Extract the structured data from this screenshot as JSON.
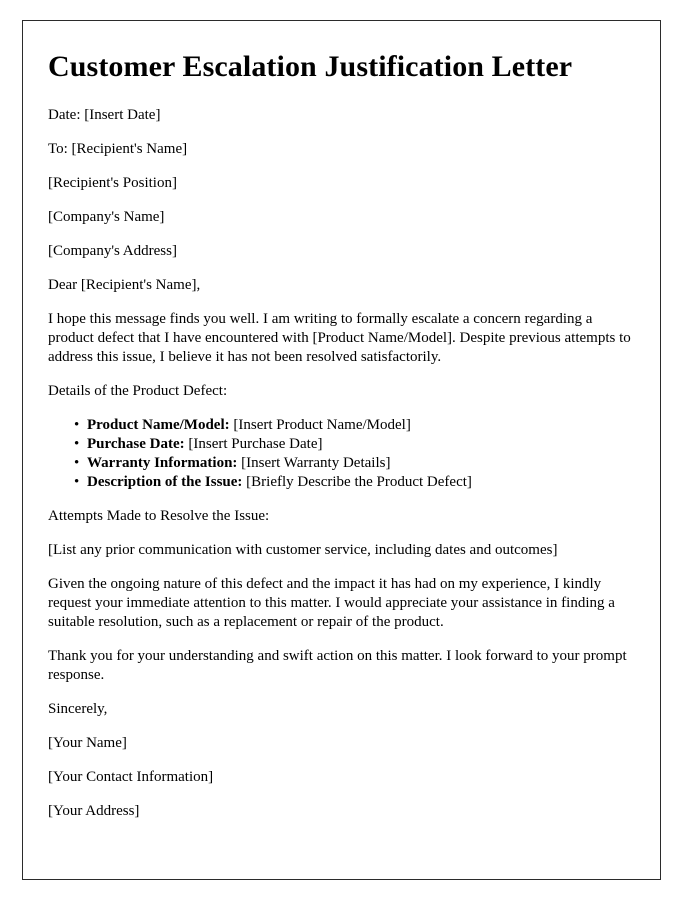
{
  "document": {
    "title": "Customer Escalation Justification Letter",
    "heading_blocks": {
      "date_line": "Date: [Insert Date]",
      "to_line": "To: [Recipient's Name]",
      "recipient_position": "[Recipient's Position]",
      "company_name": "[Company's Name]",
      "company_address": "[Company's Address]",
      "salutation": "Dear [Recipient's Name],"
    },
    "opening_paragraph": "I hope this message finds you well. I am writing to formally escalate a concern regarding a product defect that I have encountered with [Product Name/Model]. Despite previous attempts to address this issue, I believe it has not been resolved satisfactorily.",
    "details_heading": "Details of the Product Defect:",
    "detail_items": [
      {
        "label": "Product Name/Model:",
        "value": "[Insert Product Name/Model]"
      },
      {
        "label": "Purchase Date:",
        "value": "[Insert Purchase Date]"
      },
      {
        "label": "Warranty Information:",
        "value": "[Insert Warranty Details]"
      },
      {
        "label": "Description of the Issue:",
        "value": "[Briefly Describe the Product Defect]"
      }
    ],
    "attempts_heading": "Attempts Made to Resolve the Issue:",
    "attempts_placeholder": "[List any prior communication with customer service, including dates and outcomes]",
    "request_paragraph": "Given the ongoing nature of this defect and the impact it has had on my experience, I kindly request your immediate attention to this matter. I would appreciate your assistance in finding a suitable resolution, such as a replacement or repair of the product.",
    "thanks_paragraph": "Thank you for your understanding and swift action on this matter. I look forward to your prompt response.",
    "closing": "Sincerely,",
    "signature_blocks": {
      "your_name": "[Your Name]",
      "your_contact": "[Your Contact Information]",
      "your_address": "[Your Address]"
    }
  },
  "style": {
    "border_color": "#2b2b2b",
    "text_color": "#000000",
    "page_background": "#ffffff"
  }
}
